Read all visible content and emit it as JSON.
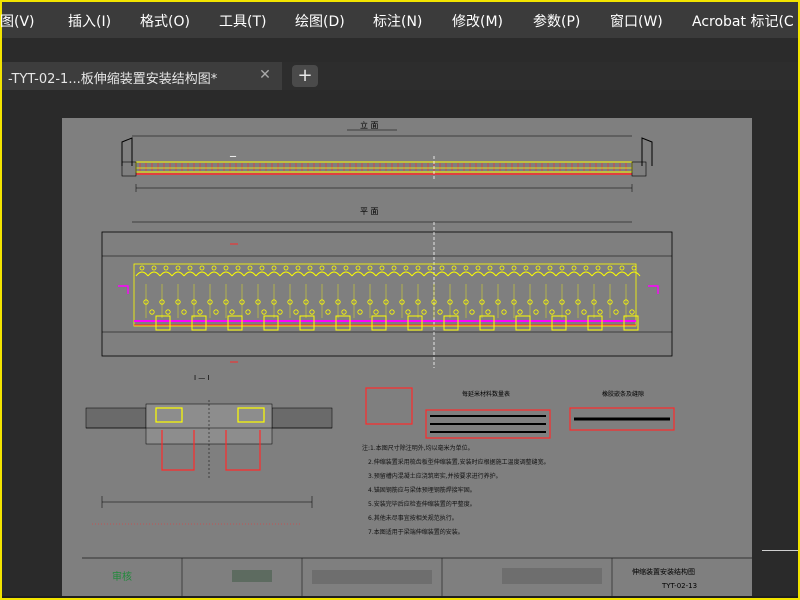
{
  "menu": {
    "items": [
      "图(V)",
      "插入(I)",
      "格式(O)",
      "工具(T)",
      "绘图(D)",
      "标注(N)",
      "修改(M)",
      "参数(P)",
      "窗口(W)",
      "Acrobat 标记(C"
    ]
  },
  "tab": {
    "title": "-TYT-02-1...板伸缩装置安装结构图*",
    "close_glyph": "✕",
    "add_glyph": "+"
  },
  "drawing": {
    "elevation_title": "立 面",
    "plan_title": "平 面",
    "section_title": "Ⅰ — Ⅰ",
    "table1_title": "每延米材料数量表",
    "table2_title": "橡胶嵌条及缝隙",
    "sheet_title": "伸缩装置安装结构图",
    "drawing_no": "TYT-02-13",
    "stamp_text": "审核",
    "notes": [
      "注:1.本图尺寸除注明外,均以毫米为单位。",
      "2.伸缩装置采用梳齿板型伸缩装置,安装时应根据施工温度调整缝宽。",
      "3.预留槽内混凝土应浇筑密实,并按要求进行养护。",
      "4.锚固钢筋应与梁体预埋钢筋焊接牢固。",
      "5.安装完毕后应检查伸缩装置的平整度。",
      "6.其他未尽事宜按相关规范执行。",
      "7.本图适用于梁端伸缩装置的安装。"
    ]
  },
  "colors": {
    "frame": "#f2e400",
    "menubar": "#3b3b3b",
    "sheet": "#7f7f7f",
    "yellow": "#ffff00",
    "red": "#ff2a2a",
    "magenta": "#ff00ff"
  }
}
